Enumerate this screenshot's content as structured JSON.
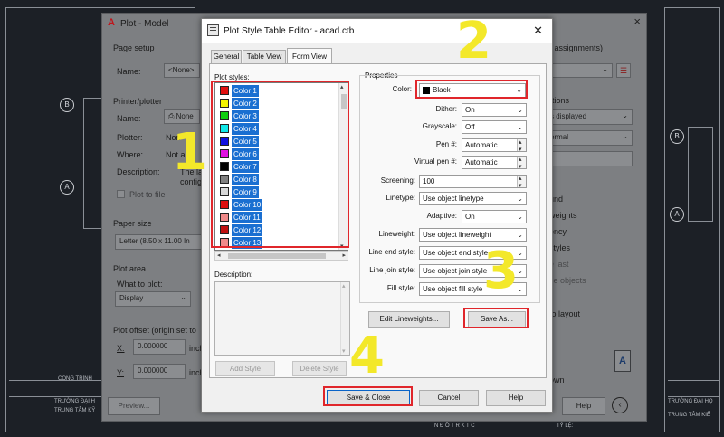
{
  "colors": {
    "accent": "#1a6fd1",
    "highlight": "#e0262b",
    "annotation": "#f3e82a"
  },
  "plot_dialog": {
    "title": "Plot - Model",
    "page_setup": {
      "heading": "Page setup",
      "name_label": "Name:",
      "name_value": "<None>"
    },
    "printer_plotter": {
      "heading": "Printer/plotter",
      "name_label": "Name:",
      "name_value": "None",
      "plotter_label": "Plotter:",
      "plotter_value": "Non",
      "where_label": "Where:",
      "where_value": "Not ap",
      "description_label": "Description:",
      "description_value_1": "The la",
      "description_value_2": "configura",
      "plot_to_file": "Plot to file"
    },
    "paper_size": {
      "heading": "Paper size",
      "value": "Letter (8.50 x 11.00 In"
    },
    "plot_area": {
      "heading": "Plot area",
      "what_to_plot_label": "What to plot:",
      "what_to_plot_value": "Display"
    },
    "plot_offset": {
      "heading": "Plot offset (origin set to",
      "x_label": "X:",
      "x_value": "0.000000",
      "y_label": "Y:",
      "y_value": "0.000000",
      "unit": "inch"
    },
    "preview_button": "Preview...",
    "help_button": "Help",
    "right_fragments": {
      "assignments": "n assignments)",
      "options": "ptions",
      "displayed": "s displayed",
      "normal": "ormal",
      "round": "und",
      "weights": "weights",
      "ency": "ency",
      "styles": "styles",
      "last": "e last",
      "objects": "ce objects",
      "to_layout": "to layout",
      "own": "own"
    }
  },
  "editor": {
    "title": "Plot Style Table Editor - acad.ctb",
    "tabs": [
      "General",
      "Table View",
      "Form View"
    ],
    "active_tab": "Form View",
    "plot_styles_label": "Plot styles:",
    "plot_styles": [
      {
        "name": "Color 1",
        "swatch": "#e01010"
      },
      {
        "name": "Color 2",
        "swatch": "#f2f200"
      },
      {
        "name": "Color 3",
        "swatch": "#10d010"
      },
      {
        "name": "Color 4",
        "swatch": "#10e8e8"
      },
      {
        "name": "Color 5",
        "swatch": "#1010e0"
      },
      {
        "name": "Color 6",
        "swatch": "#e010e0"
      },
      {
        "name": "Color 7",
        "swatch": "#000000"
      },
      {
        "name": "Color 8",
        "swatch": "#808080"
      },
      {
        "name": "Color 9",
        "swatch": "#d8d8d8"
      },
      {
        "name": "Color 10",
        "swatch": "#e01010"
      },
      {
        "name": "Color 11",
        "swatch": "#f08a8a"
      },
      {
        "name": "Color 12",
        "swatch": "#c01010"
      },
      {
        "name": "Color 13",
        "swatch": "#f08a8a"
      }
    ],
    "description_label": "Description:",
    "add_style_button": "Add Style",
    "delete_style_button": "Delete Style",
    "properties_label": "Properties",
    "properties": {
      "color": {
        "label": "Color:",
        "value": "Black",
        "swatch": "#000000"
      },
      "dither": {
        "label": "Dither:",
        "value": "On"
      },
      "grayscale": {
        "label": "Grayscale:",
        "value": "Off"
      },
      "pen": {
        "label": "Pen #:",
        "value": "Automatic"
      },
      "virtual_pen": {
        "label": "Virtual pen #:",
        "value": "Automatic"
      },
      "screening": {
        "label": "Screening:",
        "value": "100"
      },
      "linetype": {
        "label": "Linetype:",
        "value": "Use object linetype"
      },
      "adaptive": {
        "label": "Adaptive:",
        "value": "On"
      },
      "lineweight": {
        "label": "Lineweight:",
        "value": "Use object lineweight"
      },
      "line_end": {
        "label": "Line end style:",
        "value": "Use object end style"
      },
      "line_join": {
        "label": "Line join style:",
        "value": "Use object join style"
      },
      "fill": {
        "label": "Fill style:",
        "value": "Use object fill style"
      }
    },
    "edit_lineweights_button": "Edit Lineweights...",
    "save_as_button": "Save As...",
    "save_close_button": "Save & Close",
    "cancel_button": "Cancel",
    "help_button": "Help"
  },
  "annotations": [
    "1",
    "2",
    "3",
    "4"
  ],
  "cad_labels": {
    "circle_b": "B",
    "circle_a": "A",
    "title_block_1": "TRƯỜNG ĐẠI H",
    "title_block_2": "TRUNG TÂM KỸ",
    "title_block_3": "TRƯỜNG ĐẠI HỌ",
    "title_block_4": "TRUNG TÂM KIỂ",
    "cong_trinh": "CÔNG TRÌNH",
    "ty_le": "TỶ LỆ:",
    "middle_code": "N Đ Ồ T R  K T C"
  }
}
